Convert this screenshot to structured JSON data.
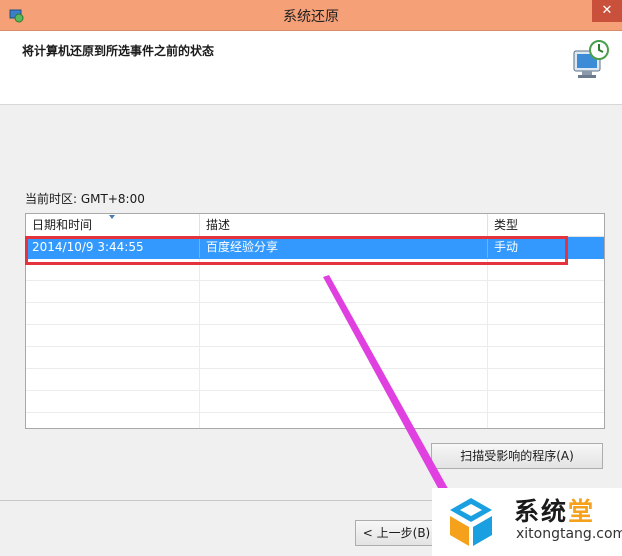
{
  "window": {
    "title": "系统还原",
    "close_label": "✕"
  },
  "header": {
    "title": "将计算机还原到所选事件之前的状态"
  },
  "timezone": "当前时区: GMT+8:00",
  "table": {
    "columns": [
      "日期和时间",
      "描述",
      "类型"
    ],
    "rows": [
      {
        "date": "2014/10/9 3:44:55",
        "description": "百度经验分享",
        "type": "手动",
        "selected": true
      }
    ]
  },
  "buttons": {
    "scan": "扫描受影响的程序(A)",
    "back": "< 上一步(B)"
  },
  "watermark": {
    "text_main": "系统",
    "text_accent": "堂",
    "url": "xitongtang.com"
  },
  "colors": {
    "titlebar": "#f6a078",
    "selection": "#3399ff",
    "highlight": "#e5333d",
    "arrow": "#e040e0"
  }
}
